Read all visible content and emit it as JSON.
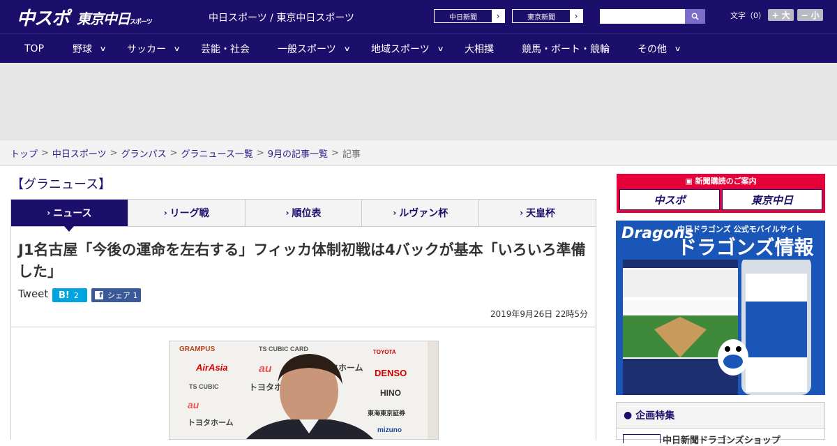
{
  "header": {
    "logo_primary": "中スポ",
    "logo_secondary": "東京中日",
    "logo_secondary_small": "スポーツ",
    "site_title": "中日スポーツ / 東京中日スポーツ",
    "paper_links": [
      {
        "label": "中日新聞"
      },
      {
        "label": "東京新聞"
      }
    ],
    "search_placeholder": "",
    "font_size_label": "文字（0）",
    "font_larger": "+ 大",
    "font_smaller": "− 小"
  },
  "nav": {
    "items": [
      {
        "label": "TOP",
        "has_dropdown": false
      },
      {
        "label": "野球",
        "has_dropdown": true
      },
      {
        "label": "サッカー",
        "has_dropdown": true
      },
      {
        "label": "芸能・社会",
        "has_dropdown": false
      },
      {
        "label": "一般スポーツ",
        "has_dropdown": true
      },
      {
        "label": "地域スポーツ",
        "has_dropdown": true
      },
      {
        "label": "大相撲",
        "has_dropdown": false
      },
      {
        "label": "競馬・ボート・競輪",
        "has_dropdown": false
      },
      {
        "label": "その他",
        "has_dropdown": true
      }
    ]
  },
  "breadcrumb": {
    "items": [
      "トップ",
      "中日スポーツ",
      "グランパス",
      "グラニュース一覧",
      "9月の記事一覧"
    ],
    "current": "記事",
    "separator": ">"
  },
  "section": {
    "title": "【グラニュース】"
  },
  "tabs": [
    {
      "label": "ニュース",
      "active": true
    },
    {
      "label": "リーグ戦",
      "active": false
    },
    {
      "label": "順位表",
      "active": false
    },
    {
      "label": "ルヴァン杯",
      "active": false
    },
    {
      "label": "天皇杯",
      "active": false
    }
  ],
  "article": {
    "headline": "J1名古屋「今後の運命を左右する」フィッカ体制初戦は4バックが基本「いろいろ準備した」",
    "tweet_label": "Tweet",
    "hatena_label": "B!",
    "hatena_count": "2",
    "fb_label": "シェア",
    "fb_count": "1",
    "date": "2019年9月26日 22時5分"
  },
  "photo": {
    "sponsor_labels": [
      "GRAMPUS",
      "TS CUBIC CARD",
      "TOYOTA",
      "AirAsia",
      "au",
      "トヨタホーム",
      "DENSO",
      "TS CUBIC",
      "トヨタホ",
      "HINO",
      "東海東京証券",
      "mizuno"
    ]
  },
  "sidebar": {
    "subscribe_title": "新聞購読のご案内",
    "subscribe_buttons": [
      "中スポ",
      "東京中日"
    ],
    "dragons_logo": "Dragons",
    "dragons_sub1": "中日ドラゴンズ 公式モバイルサイト",
    "dragons_sub2": "ドラゴンズ情報",
    "special_title": "企画特集",
    "special_item": "中日新聞ドラゴンズショップ"
  },
  "colors": {
    "brand_navy": "#1c0f6b",
    "subscribe_red": "#e60039",
    "hatena_blue": "#00a4de",
    "facebook_blue": "#3b5998",
    "dragons_blue": "#1a56b8"
  }
}
